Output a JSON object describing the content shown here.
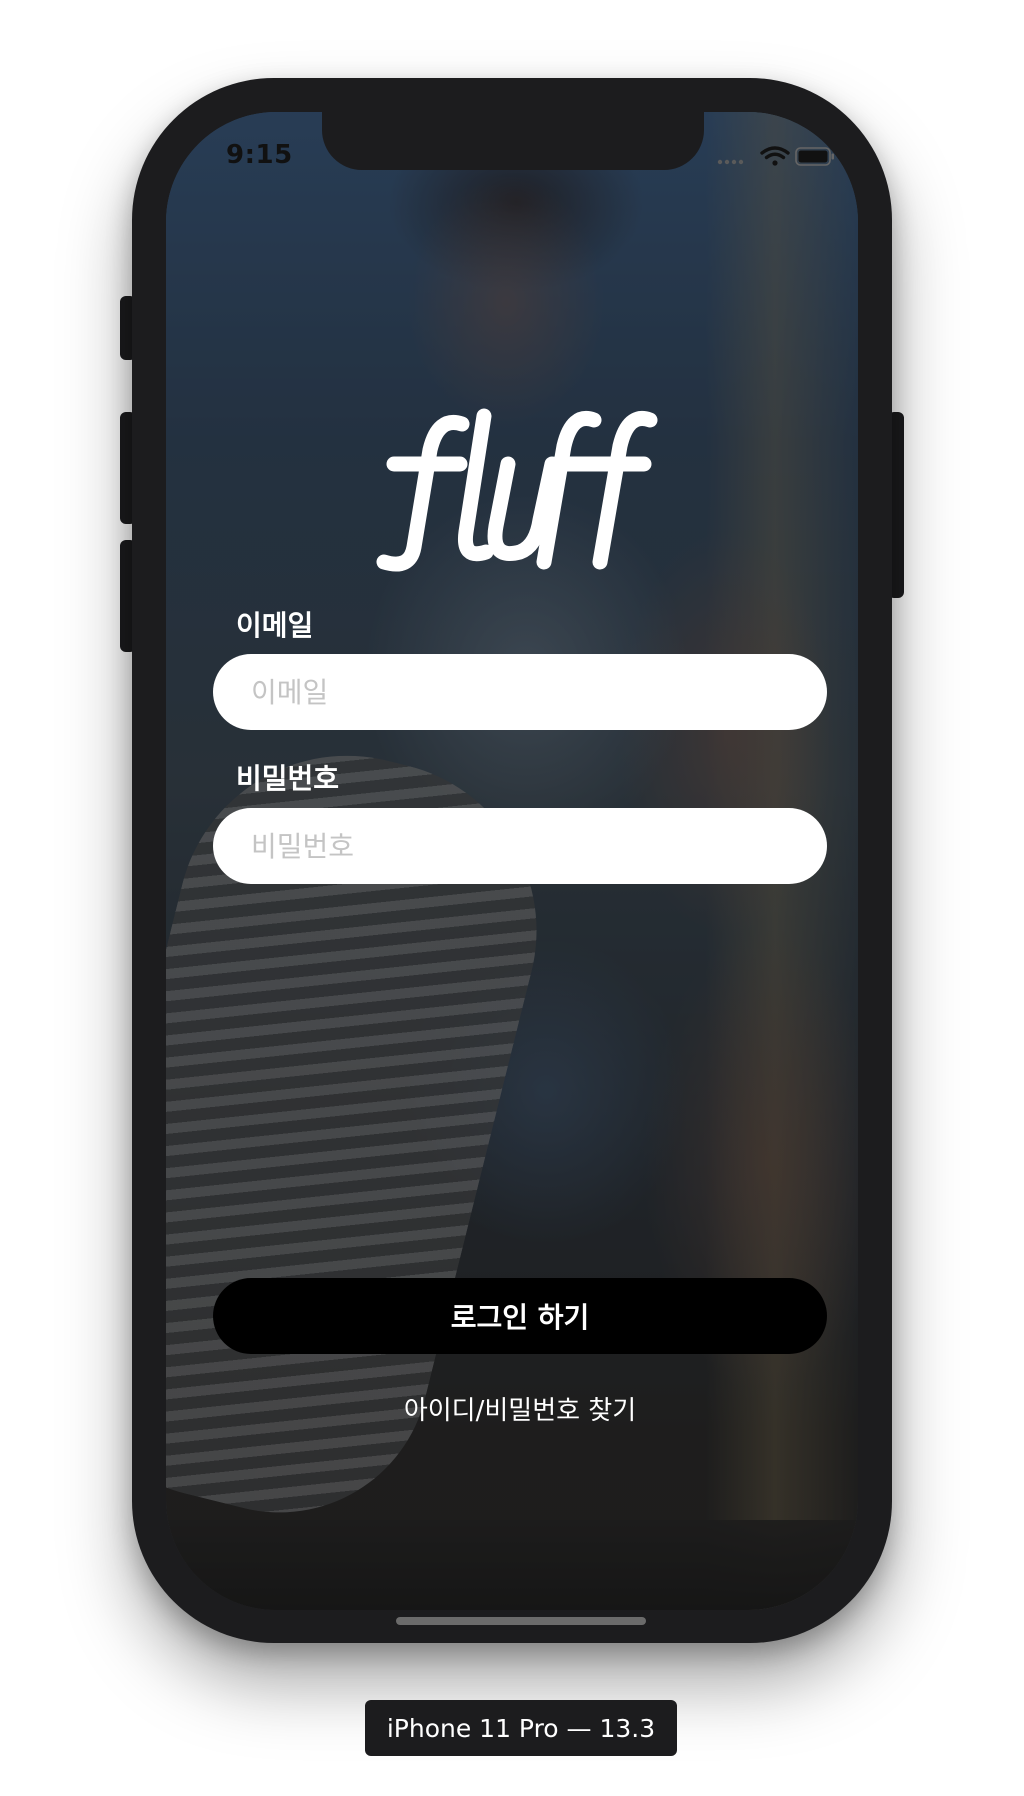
{
  "status_bar": {
    "time": "9:15"
  },
  "app": {
    "logo_text": "fluff"
  },
  "login_form": {
    "email_label": "이메일",
    "email_placeholder": "이메일",
    "email_value": "",
    "password_label": "비밀번호",
    "password_placeholder": "비밀번호",
    "password_value": "",
    "login_button_label": "로그인 하기",
    "find_account_link": "아이디/비밀번호 찾기"
  },
  "simulator": {
    "device_label": "iPhone 11 Pro — 13.3"
  },
  "colors": {
    "button_background": "#000000",
    "field_background": "#ffffff",
    "text_on_photo": "#ffffff",
    "placeholder": "#c4c4c4",
    "device_frame": "#1c1c1e"
  },
  "icons": {
    "status_signal": "cellular-signal-icon",
    "status_wifi": "wifi-icon",
    "status_battery": "battery-icon"
  }
}
